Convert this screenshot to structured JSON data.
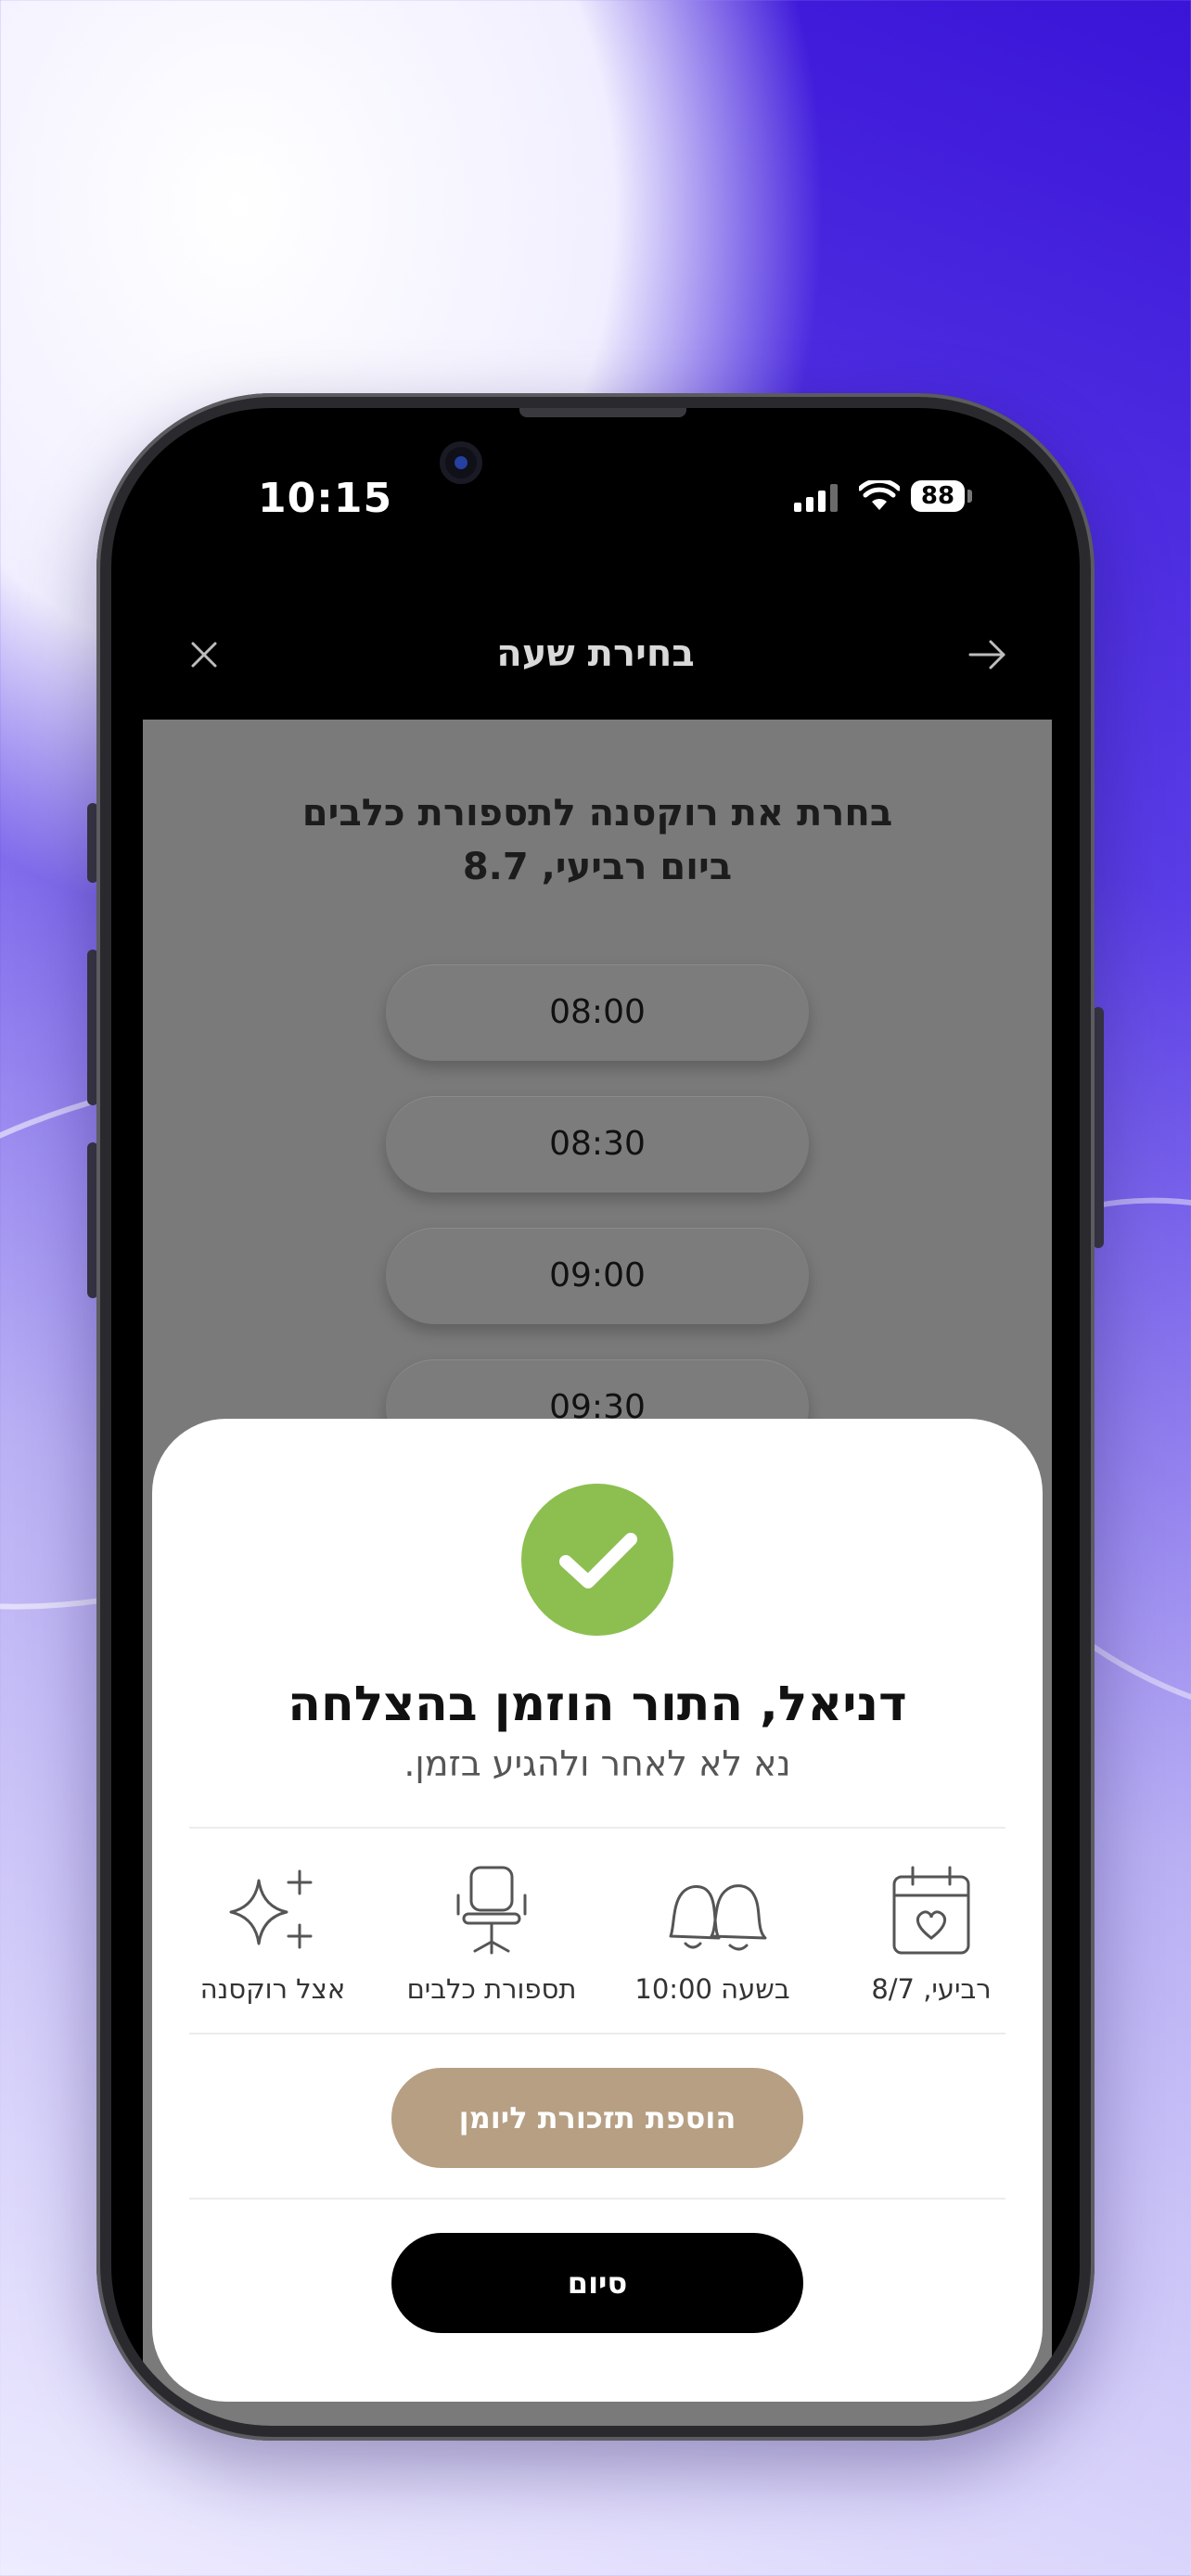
{
  "status_bar": {
    "time": "10:15",
    "battery": "88"
  },
  "nav": {
    "title": "בחירת שעה"
  },
  "content": {
    "title_line1": "בחרת את רוקסנה לתספורת כלבים",
    "title_line2": "ביום רביעי, 8.7",
    "time_slots": [
      "08:00",
      "08:30",
      "09:00",
      "09:30"
    ]
  },
  "sheet": {
    "title": "דניאל, התור הוזמן בהצלחה",
    "subtitle": "נא לא לאחר ולהגיע בזמן.",
    "details": {
      "date": "רביעי, 8/7",
      "time": "בשעה 10:00",
      "service": "תספורת כלבים",
      "provider": "אצל רוקסנה"
    },
    "add_reminder_label": "הוספת תזכורת ליומן",
    "finish_label": "סיום"
  },
  "colors": {
    "success": "#8cbf50",
    "reminder_button": "#b69f83",
    "finish_button": "#000000",
    "background_accent": "#3a14d8"
  },
  "icons": [
    "close-icon",
    "arrow-right-icon",
    "checkmark-icon",
    "calendar-heart-icon",
    "bells-icon",
    "chair-icon",
    "sparkles-icon"
  ]
}
